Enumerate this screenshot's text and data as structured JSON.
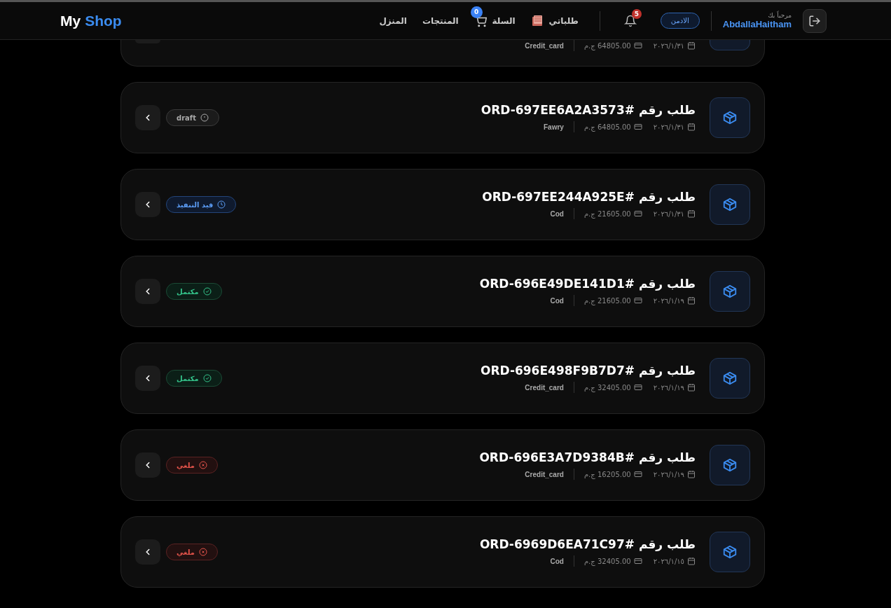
{
  "brand": {
    "first": "My",
    "second": "Shop"
  },
  "nav": [
    {
      "label": "طلباتي",
      "kind": "orders"
    },
    {
      "label": "السلة",
      "kind": "cart",
      "badge": "0"
    },
    {
      "label": "المنتجات",
      "kind": "link"
    },
    {
      "label": "المنزل",
      "kind": "link"
    }
  ],
  "notifications": {
    "badge": "5"
  },
  "role": "الادمن",
  "user": {
    "greeting": "مرحباً بك",
    "name": "AbdallaHaitham"
  },
  "orders": [
    {
      "kind": "partial",
      "date": "٢٠٢٦/١/٣١",
      "amount": "64805.00 ج.م",
      "payment": "Credit_card",
      "status": {
        "kind": "none"
      }
    },
    {
      "title": "طلب رقم #ORD-697EE6A2A3573",
      "date": "٢٠٢٦/١/٣١",
      "amount": "64805.00 ج.م",
      "payment": "Fawry",
      "status": {
        "kind": "draft",
        "label": "draft"
      }
    },
    {
      "title": "طلب رقم #ORD-697EE244A925E",
      "date": "٢٠٢٦/١/٣١",
      "amount": "21605.00 ج.م",
      "payment": "Cod",
      "status": {
        "kind": "processing",
        "label": "قيد التنفيذ"
      }
    },
    {
      "title": "طلب رقم #ORD-696E49DE141D1",
      "date": "٢٠٢٦/١/١٩",
      "amount": "21605.00 ج.م",
      "payment": "Cod",
      "status": {
        "kind": "completed",
        "label": "مكتمل"
      }
    },
    {
      "title": "طلب رقم #ORD-696E498F9B7D7",
      "date": "٢٠٢٦/١/١٩",
      "amount": "32405.00 ج.م",
      "payment": "Credit_card",
      "status": {
        "kind": "completed",
        "label": "مكتمل"
      }
    },
    {
      "title": "طلب رقم #ORD-696E3A7D9384B",
      "date": "٢٠٢٦/١/١٩",
      "amount": "16205.00 ج.م",
      "payment": "Credit_card",
      "status": {
        "kind": "cancelled",
        "label": "ملغي"
      }
    },
    {
      "title": "طلب رقم #ORD-6969D6EA71C97",
      "date": "٢٠٢٦/١/١٥",
      "amount": "32405.00 ج.م",
      "payment": "Cod",
      "status": {
        "kind": "cancelled",
        "label": "ملغي"
      }
    }
  ]
}
